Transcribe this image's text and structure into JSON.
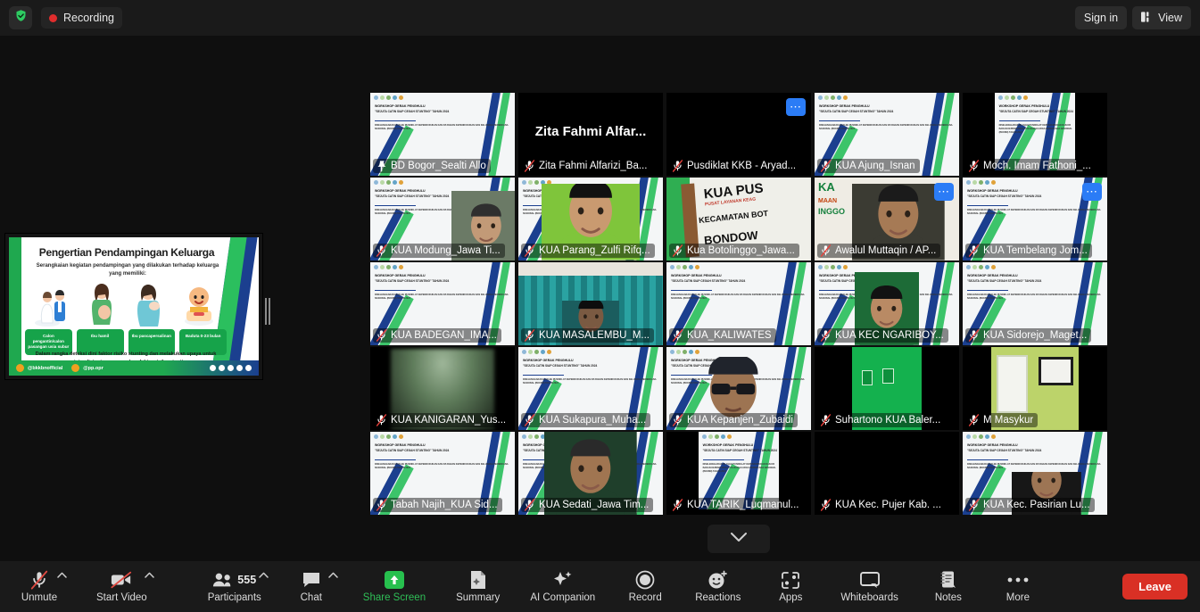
{
  "topbar": {
    "shield_icon": "shield-check-icon",
    "recording_label": "Recording",
    "signin_label": "Sign in",
    "view_label": "View",
    "view_icon": "layout-view-icon"
  },
  "share": {
    "title": "Pengertian Pendampingan Keluarga",
    "subtitle": "Serangkaian kegiatan pendampingan yang dilakukan terhadap keluarga yang memiliki:",
    "chips": [
      "Calon pengantin/calon pasangan usia subur",
      "Ibu hamil",
      "Ibu pascapersalinan",
      "Baduta 0-23 bulan"
    ],
    "footer": "Dalam rangka deteksi dini faktor risiko stunting dan melakukan upaya untuk meminimalisir atau pencegahan faktor risiko stunting",
    "handle1": "@bkkbnofficial",
    "handle2": "@pp.opr"
  },
  "slide_thumb": {
    "h1": "WORKSHOP GERAK PENGHULU",
    "h2": "\"SEJUTA CATIN SIAP CEGAH STUNTING\" TAHUN 2024",
    "h3": "DISELENGGARAKAN OLEH PUSDIKLAT KEPENDUDUKAN DAN KB BADAN KEPENDUDUKAN DAN KELUARGA BERENCANA NASIONAL (BKKBN) TAHUN 2024"
  },
  "grid": {
    "tiles": [
      {
        "name": "BD Bogor_Sealti Allo",
        "speaking": true,
        "pinned": true,
        "muted": false,
        "more": false,
        "media": "slide",
        "center_name": ""
      },
      {
        "name": "Zita Fahmi Alfarizi_Ba...",
        "speaking": false,
        "pinned": false,
        "muted": true,
        "more": false,
        "media": "nameonly",
        "center_name": "Zita Fahmi Alfar..."
      },
      {
        "name": "Pusdiklat KKB - Aryad...",
        "speaking": false,
        "pinned": false,
        "muted": true,
        "more": true,
        "media": "black",
        "center_name": ""
      },
      {
        "name": "KUA Ajung_Isnan",
        "speaking": false,
        "pinned": false,
        "muted": true,
        "more": false,
        "media": "slide",
        "center_name": ""
      },
      {
        "name": "Moch. Imam Fathoni_...",
        "speaking": false,
        "pinned": false,
        "muted": true,
        "more": false,
        "media": "slide-narrow",
        "center_name": ""
      },
      {
        "name": "KUA Modung_Jawa Ti...",
        "speaking": false,
        "pinned": false,
        "muted": true,
        "more": false,
        "media": "slide-person",
        "center_name": ""
      },
      {
        "name": "KUA Parang_Zulfi Rifq...",
        "speaking": false,
        "pinned": false,
        "muted": true,
        "more": false,
        "media": "person-green",
        "center_name": ""
      },
      {
        "name": "Kua Botolinggo_Jawa...",
        "speaking": false,
        "pinned": false,
        "muted": true,
        "more": false,
        "media": "signboard",
        "center_name": ""
      },
      {
        "name": "Awalul Muttaqin / AP...",
        "speaking": false,
        "pinned": false,
        "muted": true,
        "more": true,
        "media": "person-sign",
        "center_name": ""
      },
      {
        "name": "KUA Tembelang Jom...",
        "speaking": false,
        "pinned": false,
        "muted": true,
        "more": true,
        "media": "slide",
        "center_name": ""
      },
      {
        "name": "KUA BADEGAN_IMA...",
        "speaking": false,
        "pinned": false,
        "muted": true,
        "more": false,
        "media": "slide",
        "center_name": ""
      },
      {
        "name": "KUA MASALEMBU_M...",
        "speaking": false,
        "pinned": false,
        "muted": true,
        "more": false,
        "media": "curtain",
        "center_name": ""
      },
      {
        "name": "KUA_KALIWATES",
        "speaking": false,
        "pinned": false,
        "muted": true,
        "more": false,
        "media": "slide",
        "center_name": ""
      },
      {
        "name": "KUA KEC NGARIBOY...",
        "speaking": false,
        "pinned": false,
        "muted": true,
        "more": false,
        "media": "slide-person2",
        "center_name": ""
      },
      {
        "name": "KUA Sidorejo_Maget...",
        "speaking": false,
        "pinned": false,
        "muted": true,
        "more": false,
        "media": "slide",
        "center_name": ""
      },
      {
        "name": "KUA KANIGARAN_Yus...",
        "speaking": false,
        "pinned": false,
        "muted": true,
        "more": false,
        "media": "blurry",
        "center_name": ""
      },
      {
        "name": "KUA Sukapura_Muha...",
        "speaking": false,
        "pinned": false,
        "muted": true,
        "more": false,
        "media": "slide",
        "center_name": ""
      },
      {
        "name": "KUA Kepanjen_Zubaidi",
        "speaking": false,
        "pinned": false,
        "muted": true,
        "more": false,
        "media": "person-glasses",
        "center_name": ""
      },
      {
        "name": "Suhartono KUA Baler...",
        "speaking": false,
        "pinned": false,
        "muted": true,
        "more": false,
        "media": "greenwall",
        "center_name": ""
      },
      {
        "name": "M Masykur",
        "speaking": false,
        "pinned": false,
        "muted": true,
        "more": false,
        "media": "room",
        "center_name": ""
      },
      {
        "name": "Tabah Najih_KUA Sid...",
        "speaking": false,
        "pinned": false,
        "muted": true,
        "more": false,
        "media": "slide",
        "center_name": ""
      },
      {
        "name": "KUA Sedati_Jawa Tim...",
        "speaking": false,
        "pinned": false,
        "muted": true,
        "more": false,
        "media": "person-batik",
        "center_name": ""
      },
      {
        "name": "KUA TARIK_Luqmanul...",
        "speaking": false,
        "pinned": false,
        "muted": true,
        "more": false,
        "media": "slide-narrow",
        "center_name": ""
      },
      {
        "name": "KUA Kec. Pujer Kab. ...",
        "speaking": false,
        "pinned": false,
        "muted": true,
        "more": false,
        "media": "black",
        "center_name": ""
      },
      {
        "name": "KUA Kec. Pasirian Lu...",
        "speaking": false,
        "pinned": false,
        "muted": true,
        "more": false,
        "media": "slide-person3",
        "center_name": ""
      }
    ],
    "pager_icon": "chevron-down-icon"
  },
  "toolbar": {
    "items": [
      {
        "label": "Unmute",
        "icon": "mic-muted-icon",
        "caret": true,
        "green": false,
        "badge": ""
      },
      {
        "label": "Start Video",
        "icon": "video-off-icon",
        "caret": true,
        "green": false,
        "badge": ""
      },
      {
        "label": "Participants",
        "icon": "participants-icon",
        "caret": true,
        "green": false,
        "badge": "555"
      },
      {
        "label": "Chat",
        "icon": "chat-icon",
        "caret": true,
        "green": false,
        "badge": ""
      },
      {
        "label": "Share Screen",
        "icon": "share-screen-icon",
        "caret": false,
        "green": true,
        "badge": ""
      },
      {
        "label": "Summary",
        "icon": "summary-icon",
        "caret": false,
        "green": false,
        "badge": ""
      },
      {
        "label": "AI Companion",
        "icon": "ai-sparkle-icon",
        "caret": false,
        "green": false,
        "badge": ""
      },
      {
        "label": "Record",
        "icon": "record-icon",
        "caret": false,
        "green": false,
        "badge": ""
      },
      {
        "label": "Reactions",
        "icon": "reactions-icon",
        "caret": false,
        "green": false,
        "badge": ""
      },
      {
        "label": "Apps",
        "icon": "apps-icon",
        "caret": false,
        "green": false,
        "badge": ""
      },
      {
        "label": "Whiteboards",
        "icon": "whiteboard-icon",
        "caret": false,
        "green": false,
        "badge": ""
      },
      {
        "label": "Notes",
        "icon": "notes-icon",
        "caret": false,
        "green": false,
        "badge": ""
      },
      {
        "label": "More",
        "icon": "more-dots-icon",
        "caret": false,
        "green": false,
        "badge": ""
      }
    ],
    "leave_label": "Leave"
  },
  "colors": {
    "accent_green": "#2fbf57",
    "leave_red": "#d93025",
    "recording_red": "#e02d2d",
    "speaking_border": "#d8e82a",
    "more_blue": "#2b7cf6"
  }
}
